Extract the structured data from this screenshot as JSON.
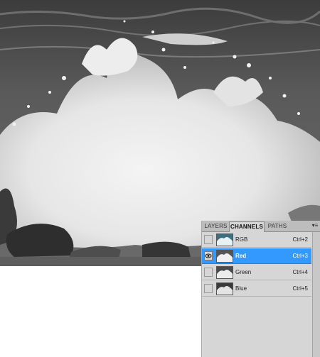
{
  "canvas": {
    "image_subject": "ocean-wave-splash-red-channel"
  },
  "panel": {
    "tabs": [
      {
        "label": "LAYERS",
        "active": false
      },
      {
        "label": "CHANNELS",
        "active": true
      },
      {
        "label": "PATHS",
        "active": false
      }
    ],
    "menu_icon": "panel-menu-icon",
    "channels": [
      {
        "name": "RGB",
        "shortcut": "Ctrl+2",
        "visible": false,
        "selected": false
      },
      {
        "name": "Red",
        "shortcut": "Ctrl+3",
        "visible": true,
        "selected": true
      },
      {
        "name": "Green",
        "shortcut": "Ctrl+4",
        "visible": false,
        "selected": false
      },
      {
        "name": "Blue",
        "shortcut": "Ctrl+5",
        "visible": false,
        "selected": false
      }
    ]
  },
  "colors": {
    "selection": "#3399ff",
    "panel_bg": "#d6d6d6",
    "tab_bar": "#bdbdbd"
  }
}
